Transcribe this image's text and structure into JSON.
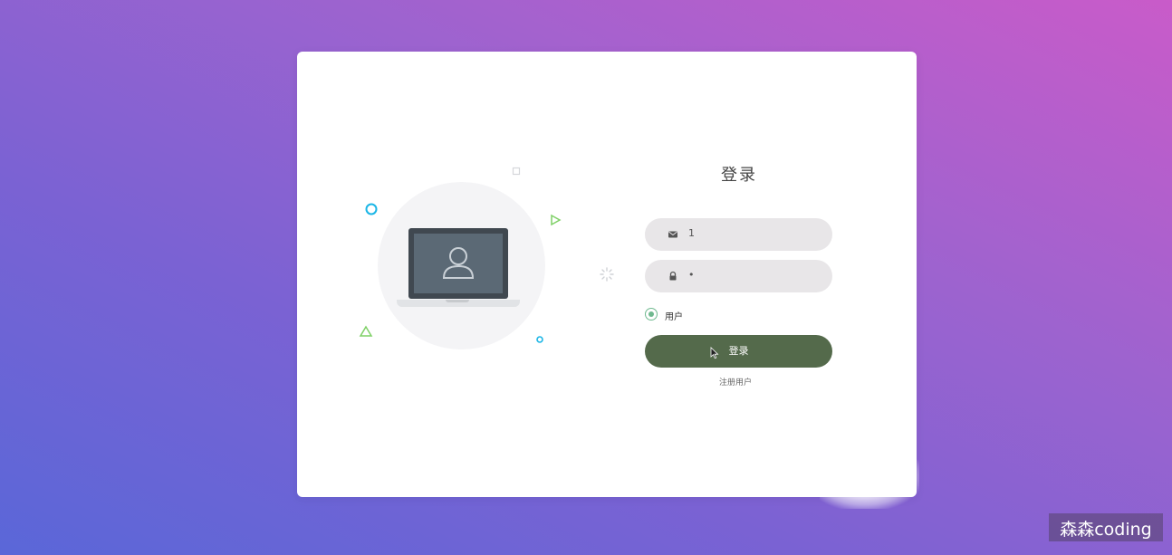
{
  "login": {
    "title": "登录",
    "email_value": "1",
    "password_value": "•",
    "role_option": "用户",
    "submit_label": "登录",
    "register_link": "注册用户"
  },
  "icons": {
    "email": "envelope-icon",
    "password": "lock-icon",
    "illustration": "laptop-user-icon"
  },
  "colors": {
    "button": "#546a4b",
    "radio": "#6fb98f",
    "field_bg": "#e8e6e8",
    "deco_blue": "#1cb6e6",
    "deco_green": "#7fd067"
  },
  "watermark": "森森coding"
}
